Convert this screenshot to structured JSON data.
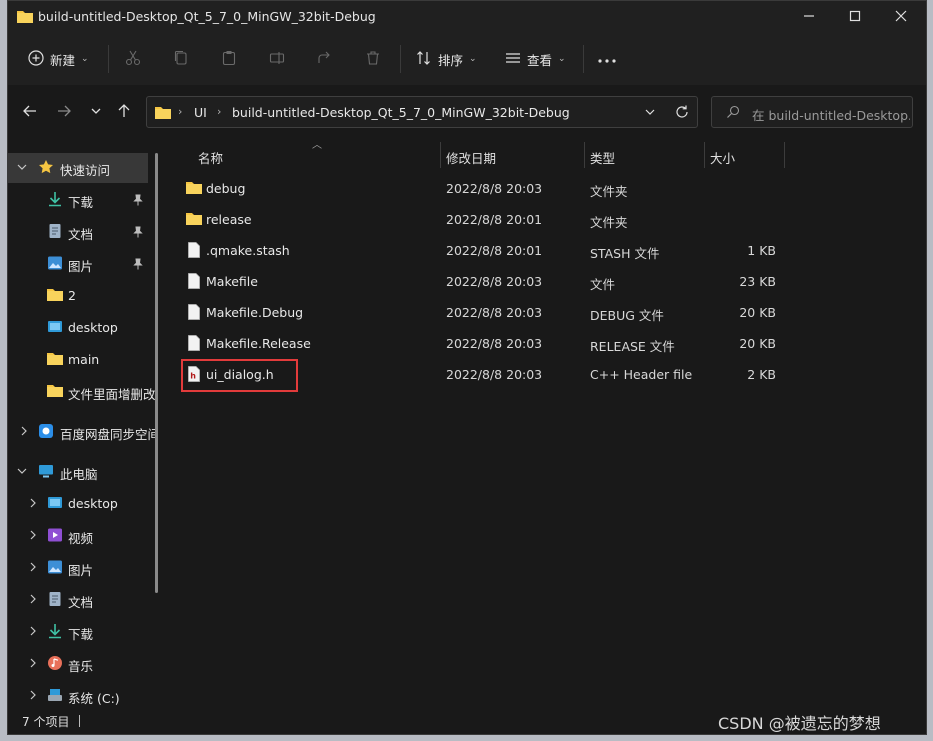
{
  "window": {
    "title": "build-untitled-Desktop_Qt_5_7_0_MinGW_32bit-Debug"
  },
  "toolbar": {
    "new_label": "新建",
    "sort_label": "排序",
    "view_label": "查看"
  },
  "address": {
    "segments": [
      "UI",
      "build-untitled-Desktop_Qt_5_7_0_MinGW_32bit-Debug"
    ]
  },
  "search": {
    "placeholder": "在 build-untitled-Desktop..."
  },
  "sidebar": {
    "items": [
      {
        "label": "快速访问",
        "icon": "star-icon"
      },
      {
        "label": "下载",
        "icon": "download-icon"
      },
      {
        "label": "文档",
        "icon": "document-icon"
      },
      {
        "label": "图片",
        "icon": "picture-icon"
      },
      {
        "label": "2",
        "icon": "folder-icon"
      },
      {
        "label": "desktop",
        "icon": "desktop-icon"
      },
      {
        "label": "main",
        "icon": "folder-icon"
      },
      {
        "label": "文件里面增删改",
        "icon": "folder-icon"
      },
      {
        "label": "百度网盘同步空间",
        "icon": "baidu-netdisk-icon"
      },
      {
        "label": "此电脑",
        "icon": "computer-icon"
      },
      {
        "label": "desktop",
        "icon": "desktop-icon"
      },
      {
        "label": "视频",
        "icon": "video-icon"
      },
      {
        "label": "图片",
        "icon": "picture-icon"
      },
      {
        "label": "文档",
        "icon": "document-icon"
      },
      {
        "label": "下载",
        "icon": "download-icon"
      },
      {
        "label": "音乐",
        "icon": "music-icon"
      },
      {
        "label": "系统 (C:)",
        "icon": "drive-icon"
      }
    ]
  },
  "columns": {
    "name": "名称",
    "date": "修改日期",
    "type": "类型",
    "size": "大小"
  },
  "files": [
    {
      "name": "debug",
      "date": "2022/8/8 20:03",
      "type": "文件夹",
      "size": "",
      "icon": "folder-icon"
    },
    {
      "name": "release",
      "date": "2022/8/8 20:01",
      "type": "文件夹",
      "size": "",
      "icon": "folder-icon"
    },
    {
      "name": ".qmake.stash",
      "date": "2022/8/8 20:01",
      "type": "STASH 文件",
      "size": "1 KB",
      "icon": "file-icon"
    },
    {
      "name": "Makefile",
      "date": "2022/8/8 20:03",
      "type": "文件",
      "size": "23 KB",
      "icon": "file-icon"
    },
    {
      "name": "Makefile.Debug",
      "date": "2022/8/8 20:03",
      "type": "DEBUG 文件",
      "size": "20 KB",
      "icon": "file-icon"
    },
    {
      "name": "Makefile.Release",
      "date": "2022/8/8 20:03",
      "type": "RELEASE 文件",
      "size": "20 KB",
      "icon": "file-icon"
    },
    {
      "name": "ui_dialog.h",
      "date": "2022/8/8 20:03",
      "type": "C++ Header file",
      "size": "2 KB",
      "icon": "header-file-icon"
    }
  ],
  "status": {
    "count": "7 个项目"
  },
  "watermark": "CSDN @被遗忘的梦想",
  "colors": {
    "folder": "#f5c542",
    "highlight": "#e23b3b"
  }
}
